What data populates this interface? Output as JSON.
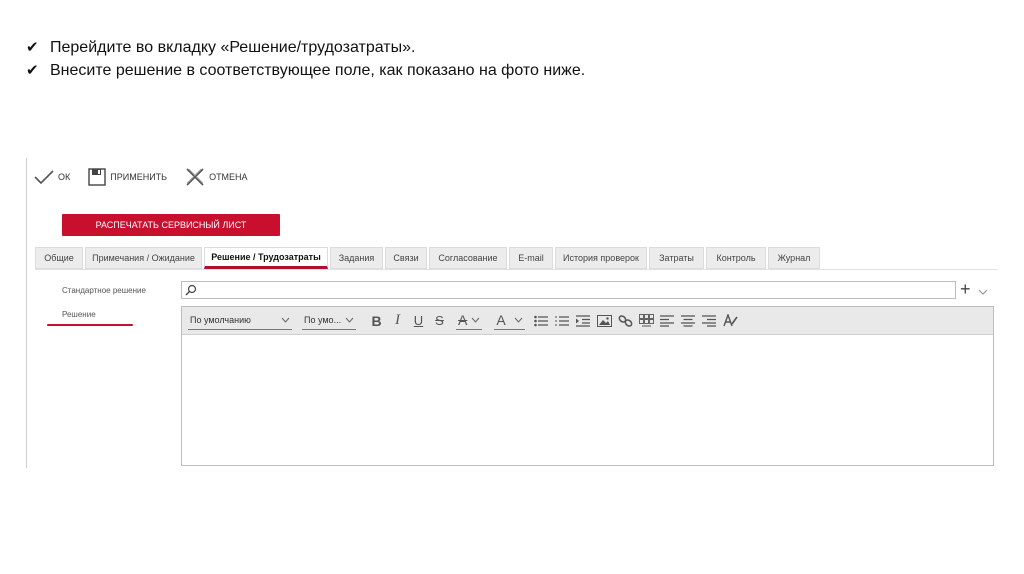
{
  "instructions": [
    "Перейдите во вкладку «Решение/трудозатраты».",
    "Внесите решение в соответствующее поле, как показано на фото ниже."
  ],
  "toolbar": {
    "ok_label": "ОК",
    "apply_label": "ПРИМЕНИТЬ",
    "cancel_label": "ОТМЕНА"
  },
  "print_button": "РАСПЕЧАТАТЬ СЕРВИСНЫЙ ЛИСТ",
  "tabs": [
    {
      "label": "Общие",
      "active": false
    },
    {
      "label": "Примечания / Ожидание",
      "active": false
    },
    {
      "label": "Решение / Трудозатраты",
      "active": true
    },
    {
      "label": "Задания",
      "active": false
    },
    {
      "label": "Связи",
      "active": false
    },
    {
      "label": "Согласование",
      "active": false
    },
    {
      "label": "E-mail",
      "active": false
    },
    {
      "label": "История проверок",
      "active": false
    },
    {
      "label": "Затраты",
      "active": false
    },
    {
      "label": "Контроль",
      "active": false
    },
    {
      "label": "Журнал",
      "active": false
    }
  ],
  "form": {
    "standard_solution_label": "Стандартное решение",
    "solution_label": "Решение",
    "search_value": ""
  },
  "editor": {
    "font_select": "По умолчанию",
    "size_select": "По умо...",
    "bold": "B",
    "italic": "I",
    "underline": "U",
    "strike": "S",
    "highlight": "A",
    "font_color": "A",
    "content": ""
  },
  "colors": {
    "accent": "#c8102e",
    "active_tab_underline": "#b01030"
  }
}
